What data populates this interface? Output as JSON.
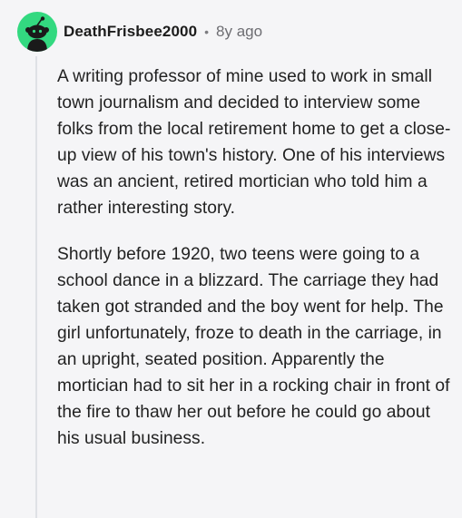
{
  "comment": {
    "author": "DeathFrisbee2000",
    "separator": "•",
    "age": "8y ago",
    "avatar_icon": "snoo-avatar-icon",
    "avatar_color": "#33d980",
    "paragraphs": [
      "A writing professor of mine used to work in small town journalism and decided to interview some folks from the local retirement home to get a close-up view of his town's history. One of his interviews was an ancient, retired mortician who told him a rather interesting story.",
      "Shortly before 1920, two teens were going to a school dance in a blizzard. The carriage they had taken got stranded and the boy went for help. The girl unfortunately, froze to death in the carriage, in an upright, seated position. Apparently the mortician had to sit her in a rocking chair in front of the fire to thaw her out before he could go about his usual business."
    ]
  }
}
